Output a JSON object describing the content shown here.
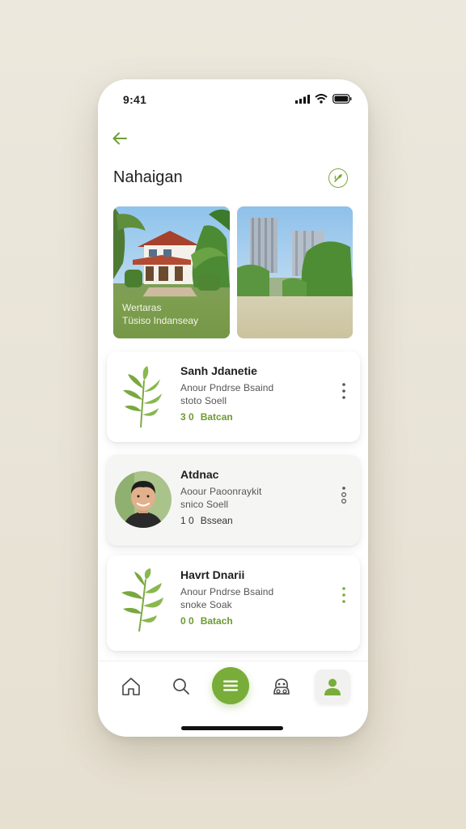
{
  "status": {
    "time": "9:41"
  },
  "header": {
    "title": "Nahaigan"
  },
  "photos": [
    {
      "caption_line1": "Wertaras",
      "caption_line2": "Tüsiso Indanseay"
    },
    {
      "caption_line1": "",
      "caption_line2": ""
    }
  ],
  "cards": [
    {
      "title": "Sanh Jdanetie",
      "line1": "Anour  Pndrse Bsaind",
      "line2": "stoto  Soell",
      "meta_num": "3  0",
      "meta_tag": "Batcan",
      "thumb": "plant-icon"
    },
    {
      "title": "Atdnac",
      "line1": "Aoour  Paoonraykit",
      "line2": "snico  Soell",
      "meta_num": "1  0",
      "meta_tag": "Bssean",
      "thumb": "avatar"
    },
    {
      "title": "Havrt Dnarii",
      "line1": "Anour  Pndrse Bsaind",
      "line2": "snoke  Soak",
      "meta_num": "0  0",
      "meta_tag": "Batach",
      "thumb": "plant-icon"
    }
  ],
  "nav": {
    "items": [
      "home-icon",
      "search-icon",
      "menu-icon",
      "face-icon",
      "profile-icon"
    ]
  },
  "colors": {
    "accent": "#79ad3a",
    "background": "#e9e5d9",
    "card": "#ffffff"
  }
}
